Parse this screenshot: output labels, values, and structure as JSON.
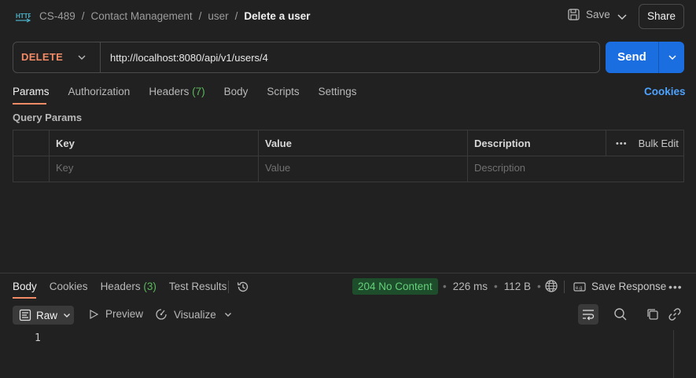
{
  "header": {
    "icon": "http-icon",
    "breadcrumbs": [
      "CS-489",
      "/",
      "Contact Management",
      "/",
      "user",
      "/"
    ],
    "current": "Delete a user",
    "save_label": "Save",
    "share_label": "Share"
  },
  "request": {
    "method": "DELETE",
    "url": "http://localhost:8080/api/v1/users/4",
    "send_label": "Send"
  },
  "tabs": {
    "params": "Params",
    "authorization": "Authorization",
    "headers": "Headers",
    "headers_count": "(7)",
    "body": "Body",
    "scripts": "Scripts",
    "settings": "Settings",
    "cookies": "Cookies"
  },
  "query_params": {
    "title": "Query Params",
    "columns": {
      "key": "Key",
      "value": "Value",
      "description": "Description"
    },
    "bulk_edit": "Bulk Edit",
    "placeholders": {
      "key": "Key",
      "value": "Value",
      "description": "Description"
    }
  },
  "response": {
    "tabs": {
      "body": "Body",
      "cookies": "Cookies",
      "headers": "Headers",
      "headers_count": "(3)",
      "test_results": "Test Results"
    },
    "status": "204 No Content",
    "time": "226 ms",
    "size": "112 B",
    "save_response": "Save Response",
    "view": {
      "format": "Raw",
      "preview": "Preview",
      "visualize": "Visualize"
    },
    "line_numbers": [
      "1"
    ]
  },
  "colors": {
    "method": "#f28b66",
    "send": "#1b6ee0",
    "status_ok": "#65d17a",
    "link": "#4da3ff"
  }
}
